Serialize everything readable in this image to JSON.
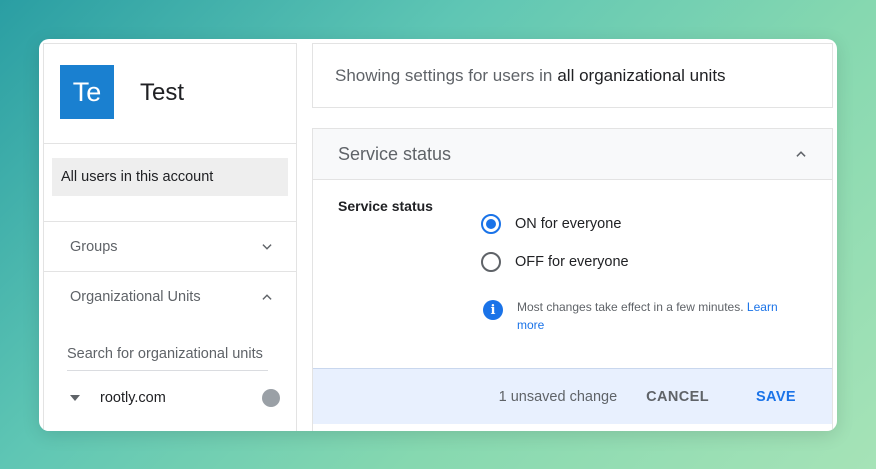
{
  "sidebar": {
    "avatar_initials": "Te",
    "account_name": "Test",
    "all_users_label": "All users in this account",
    "groups_label": "Groups",
    "org_units_label": "Organizational Units",
    "ou_search_placeholder": "Search for organizational units",
    "ou_items": [
      {
        "label": "rootly.com"
      }
    ]
  },
  "banner": {
    "prefix": "Showing settings for users in",
    "scope": "all organizational units"
  },
  "panel": {
    "title": "Service status",
    "setting_label": "Service status",
    "options": [
      {
        "label": "ON for everyone",
        "checked": true
      },
      {
        "label": "OFF for everyone",
        "checked": false
      }
    ],
    "info_text": "Most changes take effect in a few minutes.",
    "info_link": "Learn more"
  },
  "footer": {
    "unsaved_text": "1 unsaved change",
    "cancel_label": "CANCEL",
    "save_label": "SAVE"
  },
  "colors": {
    "accent": "#1a73e8",
    "avatar_bg": "#1a80d0",
    "footer_bg": "#e8f0fe"
  }
}
